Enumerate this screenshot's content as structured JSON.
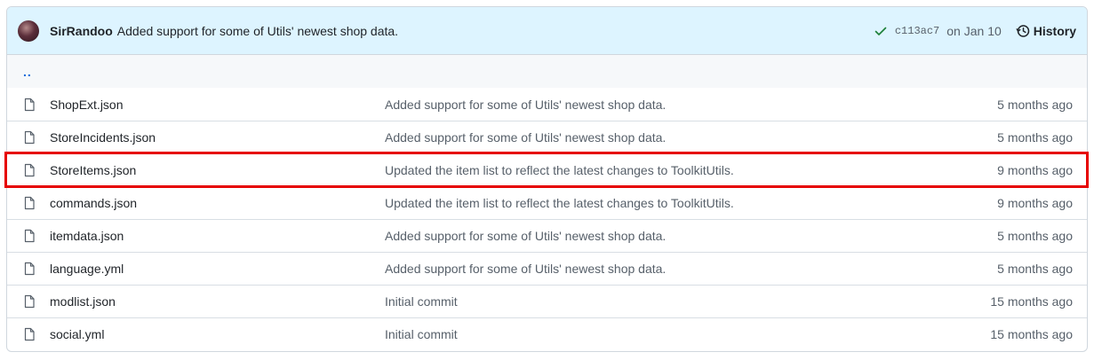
{
  "commit": {
    "author": "SirRandoo",
    "message": "Added support for some of Utils' newest shop data.",
    "status_icon": "check-icon",
    "status_color": "#1a7f37",
    "sha": "c113ac7",
    "date": "on Jan 10",
    "history_label": "History"
  },
  "parent_link": "..",
  "files": [
    {
      "name": "ShopExt.json",
      "message": "Added support for some of Utils' newest shop data.",
      "age": "5 months ago",
      "icon": "file-icon"
    },
    {
      "name": "StoreIncidents.json",
      "message": "Added support for some of Utils' newest shop data.",
      "age": "5 months ago",
      "icon": "file-icon"
    },
    {
      "name": "StoreItems.json",
      "message": "Updated the item list to reflect the latest changes to ToolkitUtils.",
      "age": "9 months ago",
      "icon": "file-icon",
      "highlighted": true
    },
    {
      "name": "commands.json",
      "message": "Updated the item list to reflect the latest changes to ToolkitUtils.",
      "age": "9 months ago",
      "icon": "file-icon"
    },
    {
      "name": "itemdata.json",
      "message": "Added support for some of Utils' newest shop data.",
      "age": "5 months ago",
      "icon": "file-icon"
    },
    {
      "name": "language.yml",
      "message": "Added support for some of Utils' newest shop data.",
      "age": "5 months ago",
      "icon": "file-icon"
    },
    {
      "name": "modlist.json",
      "message": "Initial commit",
      "age": "15 months ago",
      "icon": "file-icon"
    },
    {
      "name": "social.yml",
      "message": "Initial commit",
      "age": "15 months ago",
      "icon": "file-icon"
    }
  ],
  "colors": {
    "header_bg": "#ddf4ff",
    "link": "#0969da",
    "muted": "#57606a",
    "highlight_border": "#e60000"
  }
}
